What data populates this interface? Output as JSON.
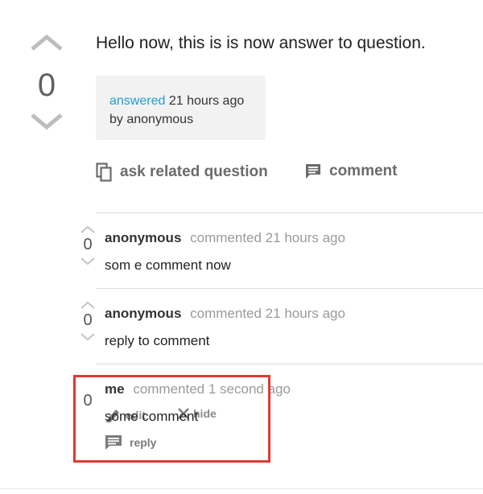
{
  "answer": {
    "vote_count": "0",
    "text": "Hello now, this is is now answer to question.",
    "meta": {
      "answered_link": "answered",
      "when": "21 hours ago",
      "by_line": "by anonymous"
    },
    "actions": {
      "ask_related": "ask related question",
      "comment": "comment"
    }
  },
  "comments": [
    {
      "vote_count": "0",
      "author": "anonymous",
      "when": "commented 21 hours ago",
      "body": "som e comment now"
    },
    {
      "vote_count": "0",
      "author": "anonymous",
      "when": "commented 21 hours ago",
      "body": "reply to comment"
    },
    {
      "vote_count": "0",
      "author": "me",
      "when": "commented 1 second ago",
      "body": "some comment",
      "tools": {
        "edit": "edit",
        "hide": "hide",
        "reply": "reply"
      }
    }
  ],
  "colors": {
    "link": "#1e9fd6",
    "highlight": "#e03a31",
    "meta_bg": "#f2f2f2"
  },
  "icons": [
    "chevron-up-icon",
    "chevron-down-icon",
    "copy-icon",
    "comment-icon",
    "pencil-icon",
    "close-icon",
    "reply-icon"
  ]
}
